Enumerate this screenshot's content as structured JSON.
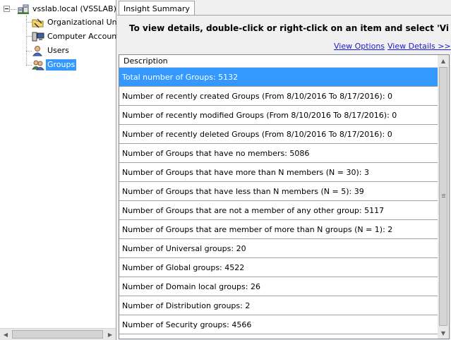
{
  "tree": {
    "root": {
      "label": "vsslab.local (VSSLAB)"
    },
    "items": [
      {
        "label": "Organizational Units",
        "icon": "ou-folder-icon"
      },
      {
        "label": "Computer Accounts",
        "icon": "computer-icon"
      },
      {
        "label": "Users",
        "icon": "user-icon"
      },
      {
        "label": "Groups",
        "icon": "group-icon",
        "selected": true
      }
    ]
  },
  "tab": {
    "label": "Insight Summary"
  },
  "instruction": "To view details, double-click or right-click on an item and select 'View",
  "links": {
    "view_options": "View Options",
    "view_details": "View Details >>"
  },
  "list": {
    "column_header": "Description",
    "rows": [
      "Total number of Groups: 5132",
      "Number of recently created Groups (From 8/10/2016 To 8/17/2016): 0",
      "Number of recently modified Groups (From 8/10/2016 To 8/17/2016): 0",
      "Number of recently deleted Groups (From 8/10/2016 To 8/17/2016): 0",
      "Number of Groups that have no members: 5086",
      "Number of Groups that have more than N members (N = 30): 3",
      "Number of Groups that have less than N members (N = 5): 39",
      "Number of Groups that are not a member of any other group: 5117",
      "Number of Groups that are member of more than N groups (N = 1): 2",
      "Number of Universal groups: 20",
      "Number of Global groups: 4522",
      "Number of Domain local groups: 26",
      "Number of Distribution groups: 2",
      "Number of Security groups: 4566"
    ],
    "selected_index": 0
  },
  "colors": {
    "selection": "#3399ff",
    "link": "#1a1ad9"
  }
}
